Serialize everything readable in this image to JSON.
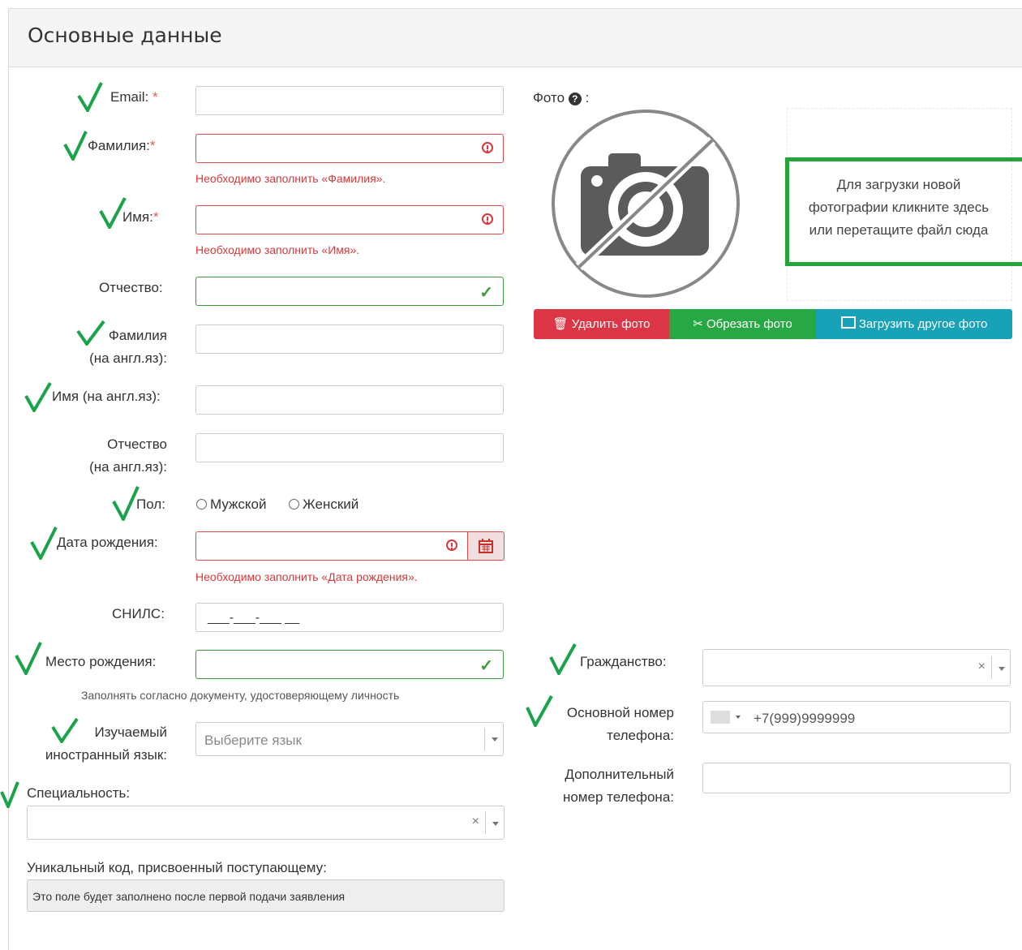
{
  "panel": {
    "title": "Основные данные"
  },
  "fields": {
    "email": {
      "label": "Email:",
      "required": "*"
    },
    "lastname": {
      "label": "Фамилия:",
      "required": "*",
      "error": "Необходимо заполнить «Фамилия»."
    },
    "firstname": {
      "label": "Имя:",
      "required": "*",
      "error": "Необходимо заполнить «Имя»."
    },
    "patronymic": {
      "label": "Отчество:"
    },
    "lastname_en": {
      "label_line1": "Фамилия",
      "label_line2": "(на англ.яз):"
    },
    "firstname_en": {
      "label": "Имя (на англ.яз):"
    },
    "patronymic_en": {
      "label_line1": "Отчество",
      "label_line2": "(на англ.яз):"
    },
    "gender": {
      "label": "Пол:",
      "options": [
        "Мужской",
        "Женский"
      ]
    },
    "birthdate": {
      "label": "Дата рождения:",
      "error": "Необходимо заполнить «Дата рождения»."
    },
    "snils": {
      "label": "СНИЛС:",
      "value": "___-___-___ __"
    },
    "birthplace": {
      "label": "Место рождения:",
      "hint": "Заполнять согласно документу, удостоверяющему личность"
    },
    "language": {
      "label_line1": "Изучаемый",
      "label_line2": "иностранный язык:",
      "placeholder": "Выберите язык"
    },
    "specialty": {
      "label": "Специальность:"
    },
    "unique_code": {
      "label": "Уникальный код, присвоенный поступающему:",
      "value": "Это поле будет заполнено после первой подачи заявления"
    },
    "citizenship": {
      "label": "Гражданство:"
    },
    "phone_main": {
      "label_line1": "Основной номер",
      "label_line2": "телефона:",
      "placeholder": "+7(999)9999999"
    },
    "phone_extra": {
      "label_line1": "Дополнительный",
      "label_line2": "номер телефона:"
    }
  },
  "photo": {
    "label": "Фото",
    "label_suffix": ":",
    "dropzone": "Для загрузки новой фотографии кликните здесь или перетащите файл сюда",
    "buttons": {
      "delete": "Удалить фото",
      "crop": "Обрезать фото",
      "upload": "Загрузить другое фото"
    }
  },
  "colors": {
    "error": "#d9383a",
    "success": "#3c9a3c",
    "check": "#1aa34a",
    "btn_delete": "#dc3545",
    "btn_crop": "#28a745",
    "btn_upload": "#17a2b8"
  }
}
